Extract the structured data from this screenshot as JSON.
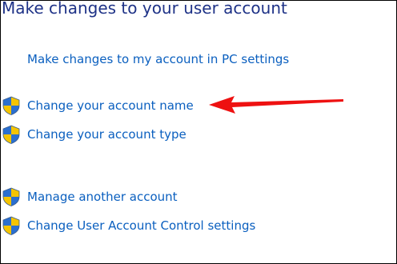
{
  "page": {
    "title": "Make changes to your user account"
  },
  "links": [
    {
      "label": "Make changes to my account in PC settings",
      "icon": ""
    },
    {
      "label": "Change your account name",
      "icon": "uac-shield-icon"
    },
    {
      "label": "Change your account type",
      "icon": "uac-shield-icon"
    },
    {
      "label": "Manage another account",
      "icon": "uac-shield-icon"
    },
    {
      "label": "Change User Account Control settings",
      "icon": "uac-shield-icon"
    }
  ],
  "annotation": {
    "icon": "red-arrow-icon",
    "color": "#ee1111"
  },
  "colors": {
    "title": "#1e3287",
    "link": "#0a5fbf",
    "shield_blue": "#2a6fd0",
    "shield_yellow": "#f5c400"
  }
}
